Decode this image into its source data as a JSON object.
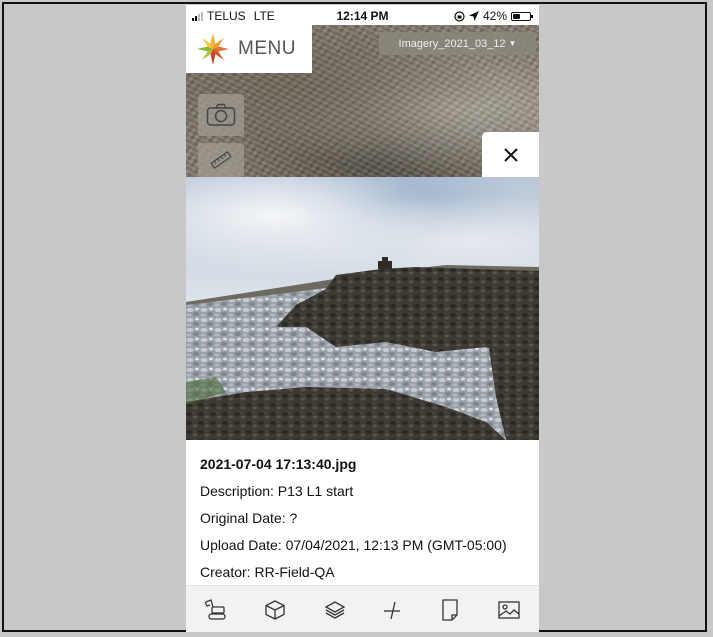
{
  "status_bar": {
    "carrier": "TELUS",
    "network": "LTE",
    "time": "12:14 PM",
    "battery": "42%",
    "battery_level": 0.42
  },
  "map": {
    "menu_label": "MENU",
    "imagery_layer": "Imagery_2021_03_12"
  },
  "photo_info": {
    "filename": "2021-07-04 17:13:40.jpg",
    "description": "Description: P13 L1 start",
    "original_date": "Original Date: ?",
    "upload_date": "Upload Date: 07/04/2021, 12:13 PM (GMT-05:00)",
    "creator": "Creator: RR-Field-QA"
  },
  "toolbar": {
    "items": [
      "excavator-icon",
      "box-3d-icon",
      "layers-icon",
      "measure-line-icon",
      "document-icon",
      "image-icon"
    ]
  },
  "colors": {
    "logo_orange": "#e8712b",
    "logo_yellow": "#f2b233",
    "logo_green": "#8bb83a",
    "logo_red": "#c9432b"
  }
}
